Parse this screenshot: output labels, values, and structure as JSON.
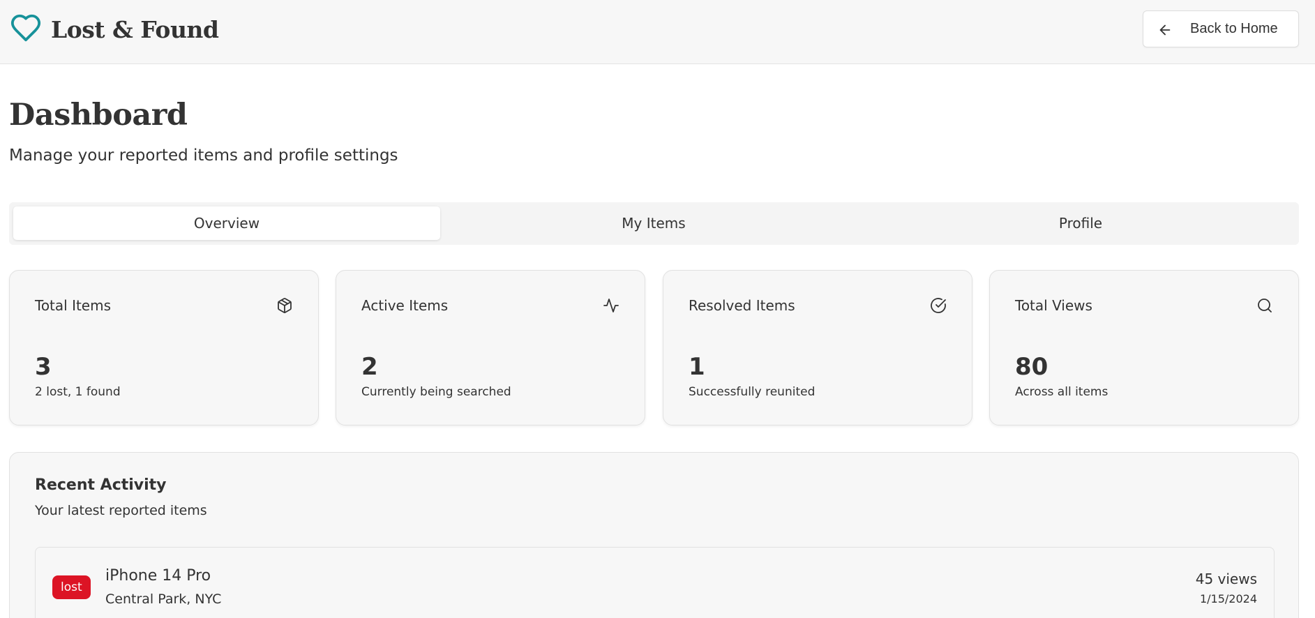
{
  "app": {
    "name": "Lost & Found",
    "logo_icon": "heart-icon",
    "brand_color": "#17929a"
  },
  "header": {
    "back_label": "Back to Home",
    "back_icon": "arrow-left-icon"
  },
  "page": {
    "title": "Dashboard",
    "subtitle": "Manage your reported items and profile settings"
  },
  "tabs": [
    {
      "label": "Overview",
      "active": true
    },
    {
      "label": "My Items",
      "active": false
    },
    {
      "label": "Profile",
      "active": false
    }
  ],
  "stats": [
    {
      "title": "Total Items",
      "value": "3",
      "desc": "2 lost, 1 found",
      "icon": "package-icon"
    },
    {
      "title": "Active Items",
      "value": "2",
      "desc": "Currently being searched",
      "icon": "activity-icon"
    },
    {
      "title": "Resolved Items",
      "value": "1",
      "desc": "Successfully reunited",
      "icon": "check-circle-icon"
    },
    {
      "title": "Total Views",
      "value": "80",
      "desc": "Across all items",
      "icon": "search-icon"
    }
  ],
  "activity": {
    "title": "Recent Activity",
    "subtitle": "Your latest reported items",
    "items": [
      {
        "status": "lost",
        "status_color": "#dc1425",
        "title": "iPhone 14 Pro",
        "location": "Central Park, NYC",
        "views": "45 views",
        "date": "1/15/2024"
      }
    ]
  }
}
